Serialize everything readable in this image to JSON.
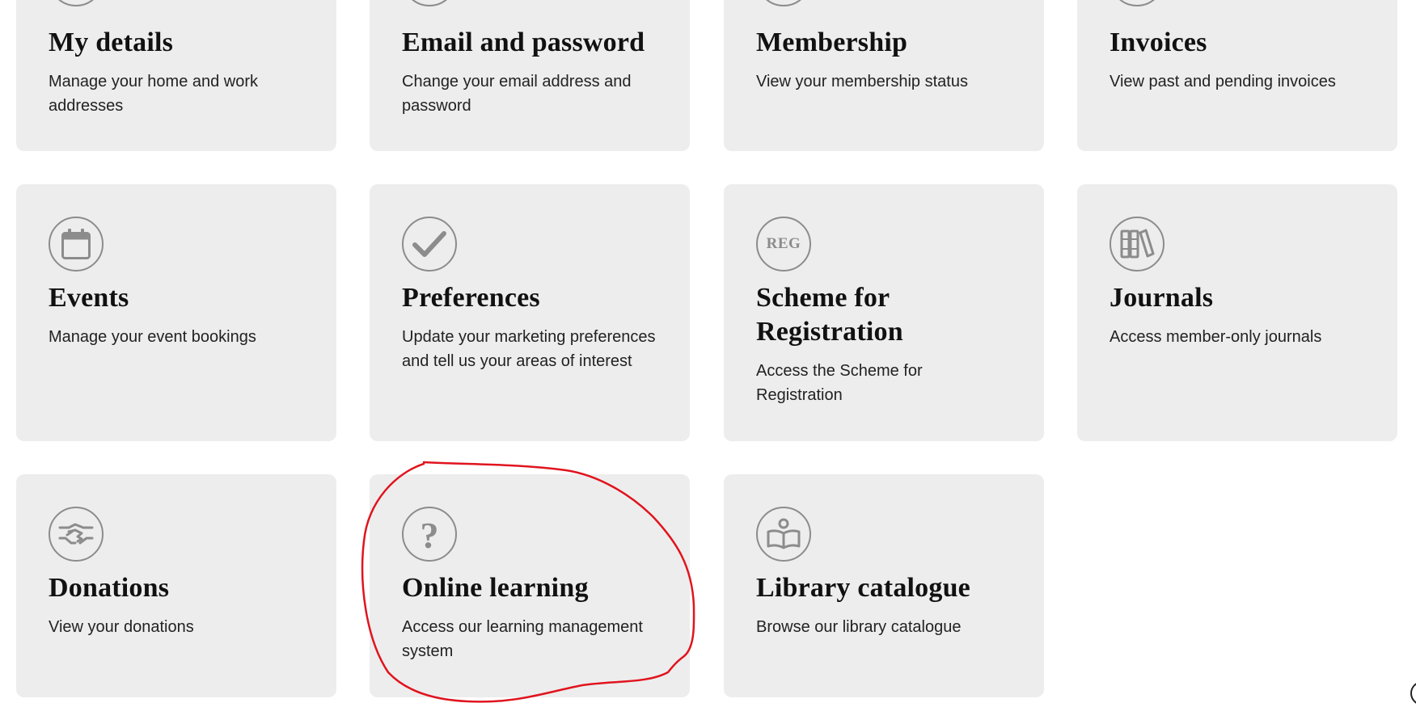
{
  "cards": [
    {
      "id": "my-details",
      "title": "My details",
      "description": "Manage your home and work addresses",
      "icon": "address-icon"
    },
    {
      "id": "email-password",
      "title": "Email and password",
      "description": "Change your email address and password",
      "icon": "lock-icon"
    },
    {
      "id": "membership",
      "title": "Membership",
      "description": "View your membership status",
      "icon": "membership-icon"
    },
    {
      "id": "invoices",
      "title": "Invoices",
      "description": "View past and pending invoices",
      "icon": "invoice-icon"
    },
    {
      "id": "events",
      "title": "Events",
      "description": "Manage your event bookings",
      "icon": "calendar-icon"
    },
    {
      "id": "preferences",
      "title": "Preferences",
      "description": "Update your marketing preferences and tell us your areas of interest",
      "icon": "checkmark-icon"
    },
    {
      "id": "scheme-registration",
      "title": "Scheme for Registration",
      "description": "Access the Scheme for Registration",
      "icon": "reg-icon",
      "icon_text": "REG"
    },
    {
      "id": "journals",
      "title": "Journals",
      "description": "Access member-only journals",
      "icon": "books-icon"
    },
    {
      "id": "donations",
      "title": "Donations",
      "description": "View your donations",
      "icon": "handshake-icon"
    },
    {
      "id": "online-learning",
      "title": "Online learning",
      "description": "Access our learning management system",
      "icon": "question-mark-icon",
      "icon_text": "?"
    },
    {
      "id": "library-catalogue",
      "title": "Library catalogue",
      "description": "Browse our library catalogue",
      "icon": "reader-icon"
    }
  ],
  "colors": {
    "card_background": "#eeeded",
    "icon_stroke": "#8c8c8c",
    "annotation": "#e0141e"
  }
}
